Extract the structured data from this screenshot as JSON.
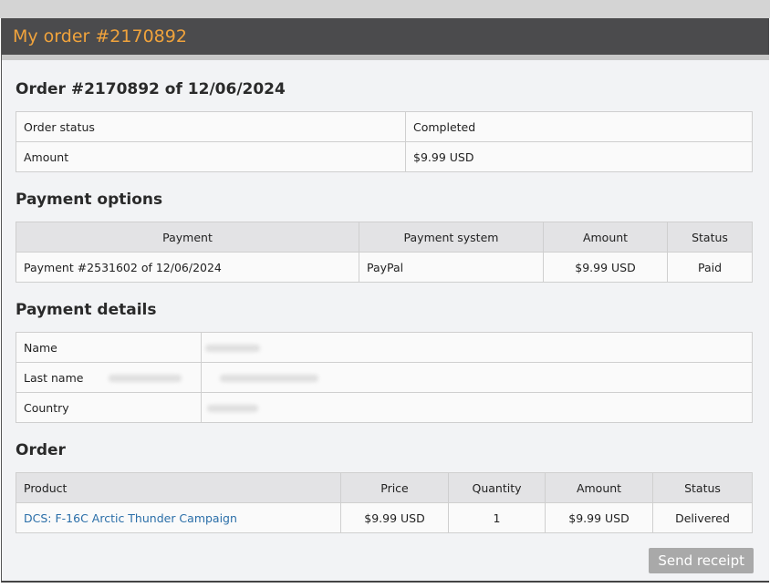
{
  "header": {
    "title": "My order #2170892"
  },
  "order_summary": {
    "title": "Order #2170892 of 12/06/2024",
    "rows": [
      {
        "label": "Order status",
        "value": "Completed"
      },
      {
        "label": "Amount",
        "value": "$9.99 USD"
      }
    ]
  },
  "payment_options": {
    "title": "Payment options",
    "headers": [
      "Payment",
      "Payment system",
      "Amount",
      "Status"
    ],
    "rows": [
      {
        "payment": "Payment #2531602 of 12/06/2024",
        "system": "PayPal",
        "amount": "$9.99 USD",
        "status": "Paid"
      }
    ]
  },
  "payment_details": {
    "title": "Payment details",
    "rows": [
      {
        "label": "Name"
      },
      {
        "label": "Last name"
      },
      {
        "label": "Country"
      }
    ]
  },
  "order": {
    "title": "Order",
    "headers": [
      "Product",
      "Price",
      "Quantity",
      "Amount",
      "Status"
    ],
    "rows": [
      {
        "product": "DCS: F-16C Arctic Thunder Campaign",
        "price": "$9.99 USD",
        "quantity": "1",
        "amount": "$9.99 USD",
        "status": "Delivered"
      }
    ]
  },
  "actions": {
    "send_receipt": "Send receipt"
  },
  "colors": {
    "header_bg": "#4b4b4d",
    "header_text": "#f0a33c",
    "link": "#2a6ea8",
    "button_bg": "#a9a9a9"
  }
}
